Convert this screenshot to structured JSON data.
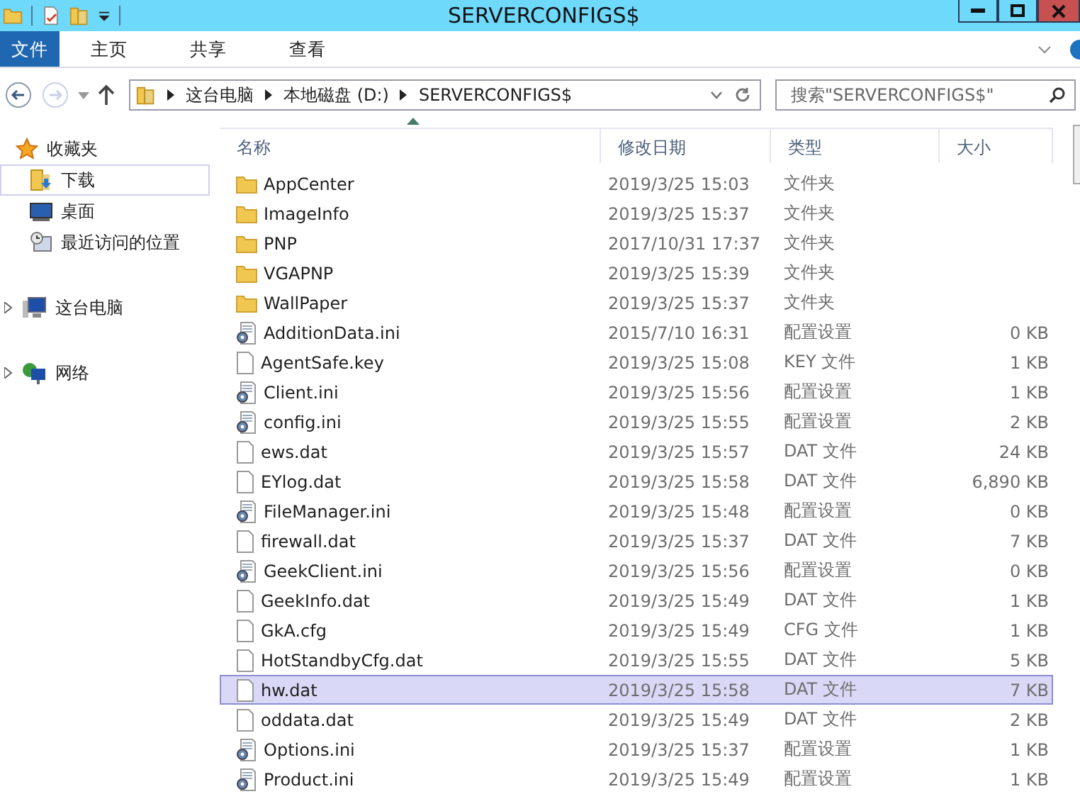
{
  "window": {
    "title": "SERVERCONFIGS$"
  },
  "ribbon_tabs": [
    {
      "label": "文件",
      "selected": true
    },
    {
      "label": "主页",
      "selected": false
    },
    {
      "label": "共享",
      "selected": false
    },
    {
      "label": "查看",
      "selected": false
    }
  ],
  "address": {
    "crumbs": [
      "这台电脑",
      "本地磁盘 (D:)",
      "SERVERCONFIGS$"
    ]
  },
  "search": {
    "placeholder": "搜索\"SERVERCONFIGS$\""
  },
  "sidebar": {
    "items": [
      {
        "label": "收藏夹",
        "kind": "star",
        "selected": false,
        "children": [
          {
            "label": "下载",
            "kind": "download",
            "selected": true
          },
          {
            "label": "桌面",
            "kind": "desktop",
            "selected": false
          },
          {
            "label": "最近访问的位置",
            "kind": "recent",
            "selected": false
          }
        ]
      },
      {
        "label": "这台电脑",
        "kind": "pc",
        "selected": false,
        "expanded": false
      },
      {
        "label": "网络",
        "kind": "network",
        "selected": false,
        "expanded": false
      }
    ]
  },
  "table": {
    "columns": [
      "名称",
      "修改日期",
      "类型",
      "大小"
    ],
    "rows": [
      {
        "name": "AppCenter",
        "date": "2019/3/25 15:03",
        "type": "文件夹",
        "size": "",
        "kind": "folder",
        "selected": false
      },
      {
        "name": "ImageInfo",
        "date": "2019/3/25 15:37",
        "type": "文件夹",
        "size": "",
        "kind": "folder",
        "selected": false
      },
      {
        "name": "PNP",
        "date": "2017/10/31 17:37",
        "type": "文件夹",
        "size": "",
        "kind": "folder",
        "selected": false
      },
      {
        "name": "VGAPNP",
        "date": "2019/3/25 15:39",
        "type": "文件夹",
        "size": "",
        "kind": "folder",
        "selected": false
      },
      {
        "name": "WallPaper",
        "date": "2019/3/25 15:37",
        "type": "文件夹",
        "size": "",
        "kind": "folder",
        "selected": false
      },
      {
        "name": "AdditionData.ini",
        "date": "2015/7/10 16:31",
        "type": "配置设置",
        "size": "0 KB",
        "kind": "ini",
        "selected": false
      },
      {
        "name": "AgentSafe.key",
        "date": "2019/3/25 15:08",
        "type": "KEY 文件",
        "size": "1 KB",
        "kind": "file",
        "selected": false
      },
      {
        "name": "Client.ini",
        "date": "2019/3/25 15:56",
        "type": "配置设置",
        "size": "1 KB",
        "kind": "ini",
        "selected": false
      },
      {
        "name": "config.ini",
        "date": "2019/3/25 15:55",
        "type": "配置设置",
        "size": "2 KB",
        "kind": "ini",
        "selected": false
      },
      {
        "name": "ews.dat",
        "date": "2019/3/25 15:57",
        "type": "DAT 文件",
        "size": "24 KB",
        "kind": "file",
        "selected": false
      },
      {
        "name": "EYlog.dat",
        "date": "2019/3/25 15:58",
        "type": "DAT 文件",
        "size": "6,890 KB",
        "kind": "file",
        "selected": false
      },
      {
        "name": "FileManager.ini",
        "date": "2019/3/25 15:48",
        "type": "配置设置",
        "size": "0 KB",
        "kind": "ini",
        "selected": false
      },
      {
        "name": "firewall.dat",
        "date": "2019/3/25 15:37",
        "type": "DAT 文件",
        "size": "7 KB",
        "kind": "file",
        "selected": false
      },
      {
        "name": "GeekClient.ini",
        "date": "2019/3/25 15:56",
        "type": "配置设置",
        "size": "0 KB",
        "kind": "ini",
        "selected": false
      },
      {
        "name": "GeekInfo.dat",
        "date": "2019/3/25 15:49",
        "type": "DAT 文件",
        "size": "1 KB",
        "kind": "file",
        "selected": false
      },
      {
        "name": "GkA.cfg",
        "date": "2019/3/25 15:49",
        "type": "CFG 文件",
        "size": "1 KB",
        "kind": "file",
        "selected": false
      },
      {
        "name": "HotStandbyCfg.dat",
        "date": "2019/3/25 15:55",
        "type": "DAT 文件",
        "size": "5 KB",
        "kind": "file",
        "selected": false
      },
      {
        "name": "hw.dat",
        "date": "2019/3/25 15:58",
        "type": "DAT 文件",
        "size": "7 KB",
        "kind": "file",
        "selected": true
      },
      {
        "name": "oddata.dat",
        "date": "2019/3/25 15:49",
        "type": "DAT 文件",
        "size": "2 KB",
        "kind": "file",
        "selected": false
      },
      {
        "name": "Options.ini",
        "date": "2019/3/25 15:37",
        "type": "配置设置",
        "size": "1 KB",
        "kind": "ini",
        "selected": false
      },
      {
        "name": "Product.ini",
        "date": "2019/3/25 15:49",
        "type": "配置设置",
        "size": "1 KB",
        "kind": "ini",
        "selected": false
      }
    ]
  }
}
